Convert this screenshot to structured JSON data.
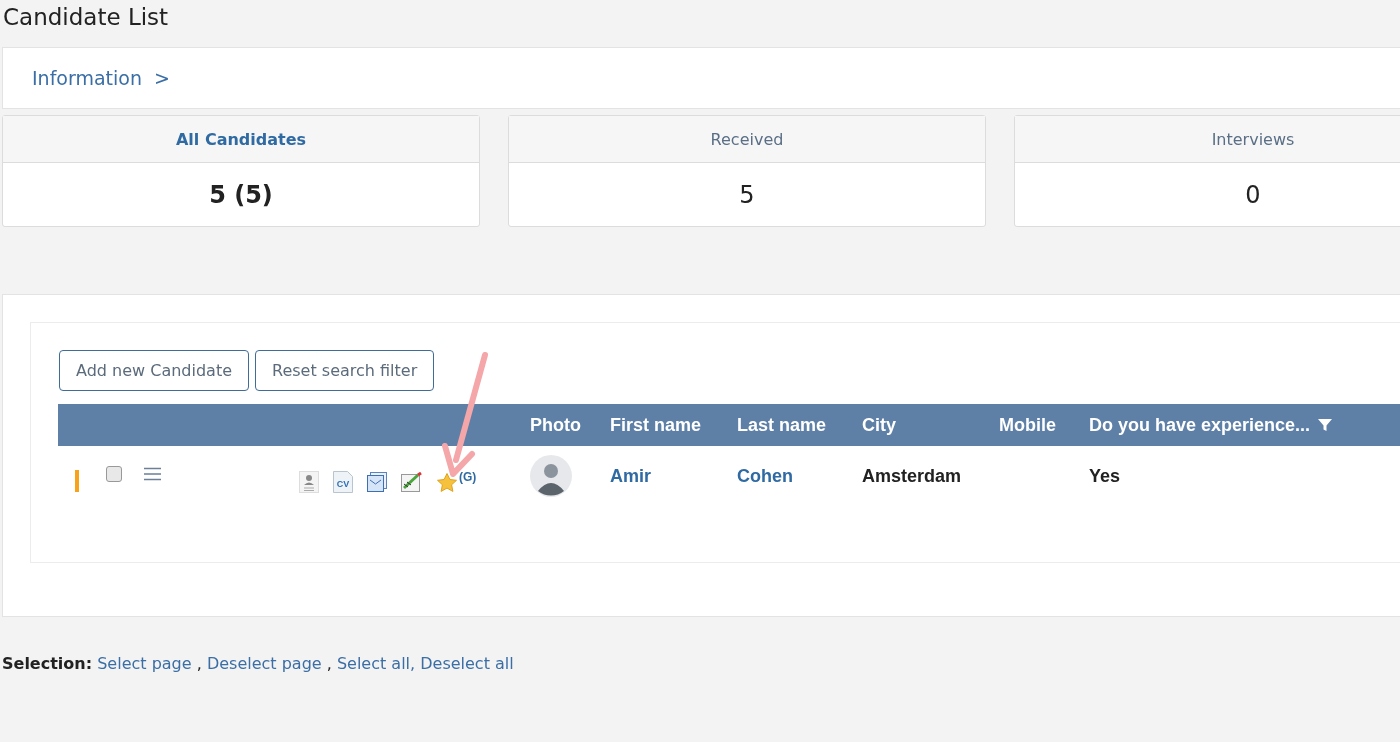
{
  "page": {
    "title": "Candidate List"
  },
  "info": {
    "label": "Information",
    "chevron": ">"
  },
  "stats": [
    {
      "label": "All Candidates",
      "value": "5 (5)",
      "selected": true
    },
    {
      "label": "Received",
      "value": "5",
      "selected": false
    },
    {
      "label": "Interviews",
      "value": "0",
      "selected": false
    }
  ],
  "buttons": [
    "Add new Candidate",
    "Reset search filter"
  ],
  "table": {
    "columns": [
      {
        "label": "Photo",
        "filterable": false
      },
      {
        "label": "First name",
        "filterable": false
      },
      {
        "label": "Last name",
        "filterable": false
      },
      {
        "label": "City",
        "filterable": false
      },
      {
        "label": "Mobile",
        "filterable": false
      },
      {
        "label": "Do you have experience...",
        "filterable": true
      }
    ],
    "rows": [
      {
        "color": "#f7a21b",
        "checked": false,
        "rating_tag": "(G)",
        "cv_label": "CV",
        "first_name": "Amir",
        "last_name": "Cohen",
        "city": "Amsterdam",
        "experience": "Yes"
      }
    ]
  },
  "selection": {
    "label": "Selection:",
    "links": [
      {
        "text": "Select page",
        "sep": ","
      },
      {
        "text": "Deselect page",
        "sep": ","
      },
      {
        "text": "Select all,"
      },
      {
        "text": "Deselect all"
      }
    ]
  }
}
